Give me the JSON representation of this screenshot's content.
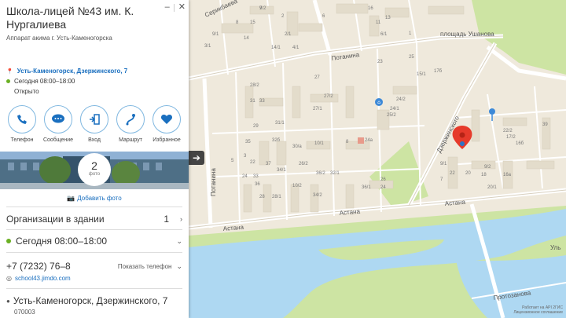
{
  "place": {
    "title": "Школа-лицей №43 им. К. Нургалиева",
    "subtitle": "Аппарат акима г. Усть-Каменогорска",
    "address_link": "Усть-Каменогорск, Дзержинского, 7",
    "hours": "Сегодня 08:00–18:00",
    "open_status": "Открыто"
  },
  "actions": [
    {
      "label": "Телефон",
      "icon": "phone-icon"
    },
    {
      "label": "Сообщение",
      "icon": "message-icon"
    },
    {
      "label": "Вход",
      "icon": "entrance-icon"
    },
    {
      "label": "Маршрут",
      "icon": "route-icon"
    },
    {
      "label": "Избранное",
      "icon": "heart-icon"
    }
  ],
  "photos": {
    "count": "2",
    "count_label": "фото",
    "add_label": "Добавить фото"
  },
  "details": {
    "orgs_label": "Организации в здании",
    "orgs_count": "1",
    "hours": "Сегодня 08:00–18:00",
    "phone": "+7 (7232) 76–8",
    "show_phone": "Показать телефон",
    "website": "school43.jimdo.com",
    "address": "Усть-Каменогорск, Дзержинского, 7",
    "postal": "070003"
  },
  "map": {
    "streets": {
      "potanina_top": "Потанина",
      "potanina_left": "Потанина",
      "dzerzhinskogo": "Дзержинского",
      "astana_left": "Астана",
      "astana_mid": "Астана",
      "astana_right": "Астана",
      "serikbaeva": "Серикбаева",
      "ushanova": "площадь Ушанова",
      "protozanova": "Протозанова",
      "ul": "Уль"
    },
    "buildings": [
      "9",
      "14/1",
      "14",
      "8",
      "9/1",
      "3/1",
      "15",
      "2",
      "2/1",
      "4/1",
      "6",
      "16",
      "11",
      "6/1",
      "13",
      "1",
      "15/1",
      "17б",
      "23",
      "25",
      "27",
      "27/2",
      "27/1",
      "25/2",
      "24/2",
      "24/1",
      "33",
      "29",
      "31/1",
      "32б",
      "30/а",
      "10/1",
      "8",
      "24а",
      "34/1",
      "10/2",
      "36/2",
      "34/2",
      "32/1",
      "36",
      "36/1",
      "24",
      "26",
      "22",
      "20",
      "20/1",
      "18",
      "22/2",
      "17/2",
      "16б",
      "16а",
      "9/2",
      "9/1",
      "7",
      "3",
      "5",
      "22",
      "28",
      "28/1",
      "26/2",
      "24",
      "33",
      "28/2",
      "31",
      "35",
      "37",
      "39",
      "7/2"
    ],
    "footer_line1": "Работает на API 2ГИС",
    "footer_line2": "Лицензионное соглашение"
  },
  "colors": {
    "accent": "#1a6fbf",
    "open": "#6ab023",
    "water": "#aed8f2",
    "park": "#cde4a3",
    "ground": "#efe9dc",
    "road": "#ffffff",
    "marker": "#e63a2b"
  }
}
